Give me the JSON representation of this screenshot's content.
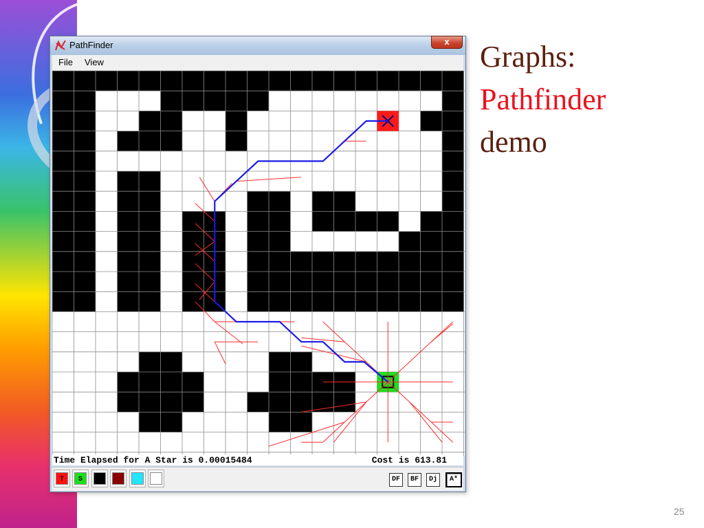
{
  "slide": {
    "title_line1": "Graphs:",
    "title_line2": "Pathfinder",
    "title_line3": "demo",
    "page_number": "25"
  },
  "window": {
    "title": "PathFinder",
    "close_label": "x",
    "app_icon": "pathfinder-app-icon",
    "menu": [
      "File",
      "View"
    ]
  },
  "grid": {
    "cols": 19,
    "rows": 19,
    "colors": {
      "wall": "#000000",
      "open": "#ffffff",
      "target": "#ff1a1a",
      "source": "#22dd22",
      "path": "#1a1ae6",
      "explored": "#ff2a2a",
      "gridline": "#8c8c8c"
    },
    "walls": [
      "1111111111111111111",
      "1100011111000000001",
      "1100110010000000011",
      "1101110010000000001",
      "1100000000000000001",
      "1101100000000000001",
      "1101100001101100001",
      "1101101101101111011",
      "1101101101100000111",
      "1101101101111111111",
      "1101101101111111111",
      "1101101101111111111",
      "0000000000000000000",
      "0000000000000000000",
      "0000110000110000000",
      "0001111000111100000",
      "0001111001111100000",
      "0000110000110000000",
      "0000000000000000000"
    ],
    "target_cell": {
      "col": 15,
      "row": 2
    },
    "source_cell": {
      "col": 15,
      "row": 15
    }
  },
  "status": {
    "left": "Time Elapsed for A Star is 0.00015484",
    "right": "Cost is 613.81"
  },
  "toolbar": {
    "swatches": [
      {
        "label": "T",
        "color": "#ff1010"
      },
      {
        "label": "S",
        "color": "#19e019"
      },
      {
        "label": "",
        "color": "#000000"
      },
      {
        "label": "",
        "color": "#8b0000"
      },
      {
        "label": "",
        "color": "#22e5ff"
      },
      {
        "label": "",
        "color": "#ffffff"
      }
    ],
    "algorithms": [
      "DF",
      "BF",
      "Dj",
      "A*"
    ],
    "active_algorithm": "A*"
  }
}
